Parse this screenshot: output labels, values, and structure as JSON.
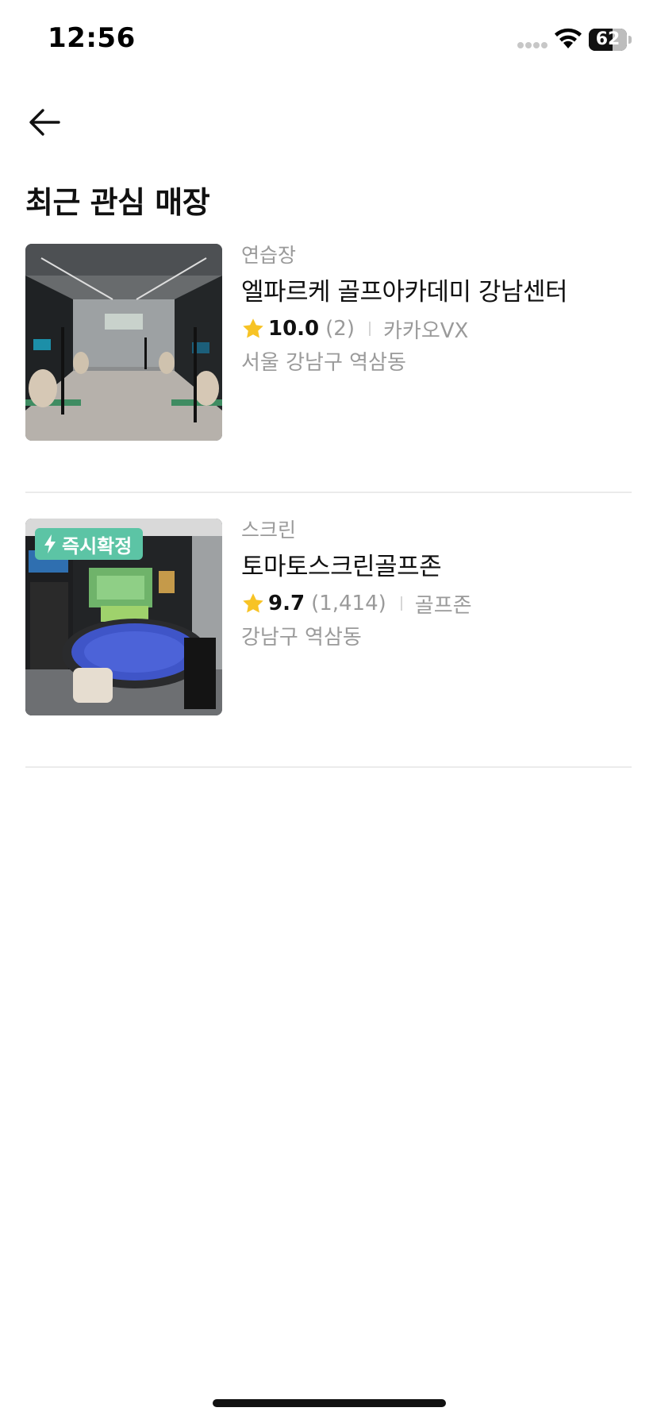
{
  "status_bar": {
    "time": "12:56",
    "battery_percent": "62",
    "battery_level": 0.62
  },
  "header": {
    "title": "최근 관심 매장",
    "back_icon": "arrow-left-icon"
  },
  "stores": [
    {
      "category": "연습장",
      "name": "엘파르케 골프아카데미 강남센터",
      "rating": "10.0",
      "review_count": "(2)",
      "brand": "카카오VX",
      "address": "서울 강남구 역삼동",
      "badge": ""
    },
    {
      "category": "스크린",
      "name": "토마토스크린골프존",
      "rating": "9.7",
      "review_count": "(1,414)",
      "brand": "골프존",
      "address": "강남구 역삼동",
      "badge": "즉시확정"
    }
  ],
  "colors": {
    "badge_bg": "#5cc4a5",
    "star": "#f7c325",
    "muted": "#9a9a9a",
    "divider": "#ebebeb"
  }
}
